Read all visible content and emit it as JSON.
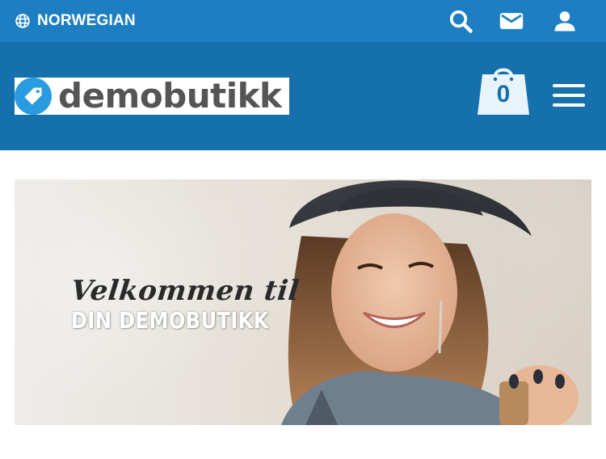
{
  "topbar": {
    "language_label": "NORWEGIAN",
    "icons": [
      "globe-icon",
      "search-icon",
      "mail-icon",
      "user-icon"
    ]
  },
  "header": {
    "logo_text": "demobutikk",
    "cart_count": "0",
    "icons": [
      "tag-icon",
      "shopping-bag-icon",
      "hamburger-menu-icon"
    ]
  },
  "banner": {
    "line1": "Velkommen til",
    "line2": "DIN DEMOBUTIKK"
  },
  "colors": {
    "topbar": "#1d7fc2",
    "header": "#1570ac",
    "logo_badge": "#2b9be0",
    "logo_text": "#555555"
  }
}
